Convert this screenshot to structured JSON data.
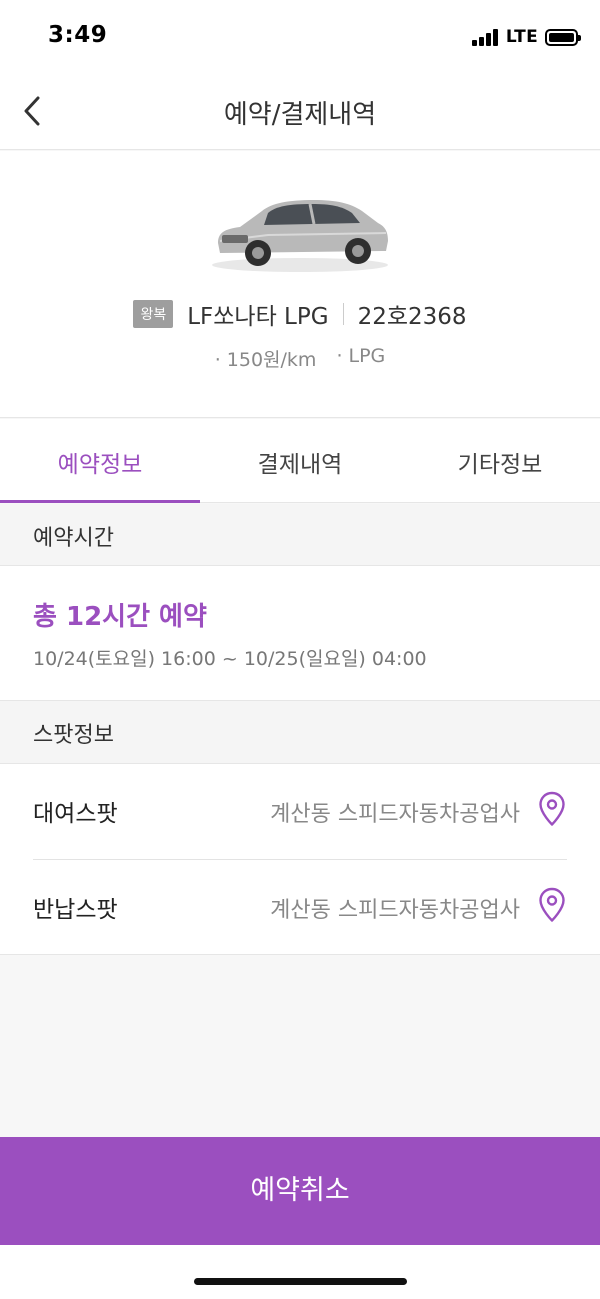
{
  "status_bar": {
    "time": "3:49",
    "network": "LTE"
  },
  "header": {
    "title": "예약/결제내역",
    "back_icon": "chevron-left-icon"
  },
  "car": {
    "trip_type": "왕복",
    "model": "LF쏘나타 LPG",
    "plate": "22호2368",
    "price": "· 150원/km",
    "fuel": "· LPG",
    "image": "silver-sedan-image"
  },
  "tabs": [
    {
      "label": "예약정보",
      "active": true
    },
    {
      "label": "결제내역",
      "active": false
    },
    {
      "label": "기타정보",
      "active": false
    }
  ],
  "reservation": {
    "section_title": "예약시간",
    "total": "총 12시간 예약",
    "range": "10/24(토요일) 16:00 ~ 10/25(일요일) 04:00"
  },
  "spot": {
    "section_title": "스팟정보",
    "rows": [
      {
        "label": "대여스팟",
        "value": "계산동 스피드자동차공업사",
        "icon": "location-pin-icon"
      },
      {
        "label": "반납스팟",
        "value": "계산동 스피드자동차공업사",
        "icon": "location-pin-icon"
      }
    ]
  },
  "actions": {
    "cancel_label": "예약취소"
  },
  "colors": {
    "accent": "#9b4fbf",
    "badge": "#9e9e9e",
    "background": "#f7f7f7"
  }
}
